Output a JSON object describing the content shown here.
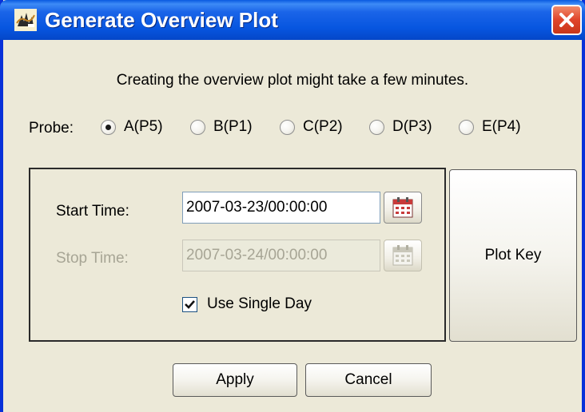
{
  "window": {
    "title": "Generate Overview Plot"
  },
  "icons": {
    "app": "app-icon",
    "close": "close-icon",
    "calendar": "calendar-icon"
  },
  "info_text": "Creating the overview plot might take a few minutes.",
  "probe": {
    "label": "Probe:",
    "options": [
      "A(P5)",
      "B(P1)",
      "C(P2)",
      "D(P3)",
      "E(P4)"
    ],
    "selected": "A(P5)"
  },
  "time_range": {
    "start_label": "Start Time:",
    "start_value": "2007-03-23/00:00:00",
    "stop_label": "Stop Time:",
    "stop_value": "2007-03-24/00:00:00",
    "stop_enabled": false,
    "single_day_label": "Use Single Day",
    "single_day_checked": true
  },
  "buttons": {
    "plot_key": "Plot Key",
    "apply": "Apply",
    "cancel": "Cancel"
  },
  "colors": {
    "titlebar": "#0756e0",
    "close_button": "#e0442a",
    "dialog_bg": "#ece9d8",
    "disabled_text": "#a7a595"
  }
}
